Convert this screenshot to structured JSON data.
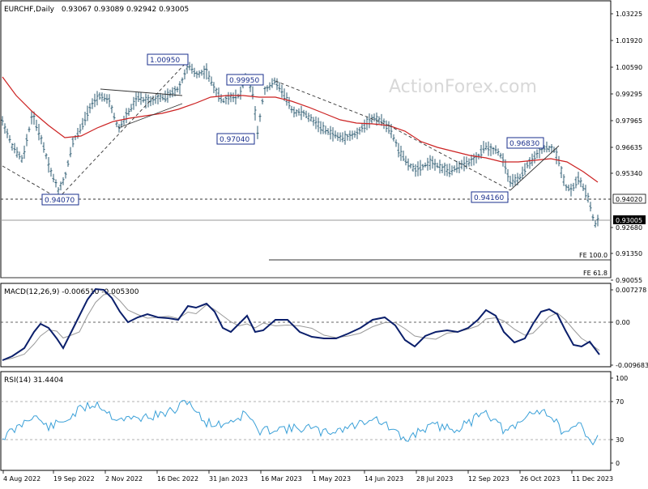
{
  "header": {
    "symbol": "EURCHF,Daily",
    "ohlc": "0.93067 0.93089 0.92942 0.93005"
  },
  "watermark": "ActionForex.com",
  "colors": {
    "candles": "#2f5d73",
    "ma": "#cc2222",
    "macd_line": "#0b1f6b",
    "macd_signal": "#999999",
    "rsi": "#3aa0d8",
    "box_border": "#1a2f8c",
    "dashed": "#333333"
  },
  "main_panel": {
    "price_axis_labels": [
      "1.03225",
      "1.01920",
      "1.00590",
      "0.99295",
      "0.97965",
      "0.96635",
      "0.95340",
      "0.94020",
      "0.93005",
      "0.92680",
      "0.91350",
      "0.90055"
    ],
    "current_price_label": "0.93005",
    "level_label_9402": "0.94020",
    "fe_labels": [
      "FE 100.0",
      "FE 61.8"
    ],
    "callouts": [
      "1.00950",
      "0.99950",
      "0.97040",
      "0.94070",
      "0.94160",
      "0.96830"
    ]
  },
  "macd_panel": {
    "title": "MACD(12,26,9) -0.006510 -0.005300",
    "axis_labels": [
      "0.007278",
      "0.00",
      "-0.009683"
    ]
  },
  "rsi_panel": {
    "title": "RSI(14) 31.4404",
    "axis_labels": [
      "100",
      "70",
      "30",
      "0"
    ]
  },
  "x_axis_labels": [
    "4 Aug 2022",
    "19 Sep 2022",
    "2 Nov 2022",
    "16 Dec 2022",
    "31 Jan 2023",
    "16 Mar 2023",
    "1 May 2023",
    "14 Jun 2023",
    "28 Jul 2023",
    "12 Sep 2023",
    "26 Oct 2023",
    "11 Dec 2023"
  ],
  "chart_data": [
    {
      "type": "line",
      "title": "EURCHF,Daily",
      "x": [
        "4 Aug 2022",
        "19 Sep 2022",
        "2 Nov 2022",
        "16 Dec 2022",
        "31 Jan 2023",
        "16 Mar 2023",
        "1 May 2023",
        "14 Jun 2023",
        "28 Jul 2023",
        "12 Sep 2023",
        "26 Oct 2023",
        "11 Dec 2023"
      ],
      "series": [
        {
          "name": "",
          "values": [
            0.978,
            0.944,
            0.972,
            0.986,
            0.994,
            0.987,
            0.973,
            0.974,
            0.953,
            0.964,
            0.963,
            0.93
          ]
        }
      ],
      "ylim": [
        0.9005,
        1.0323
      ]
    },
    {
      "type": "line",
      "title": "MACD(12,26,9) -0.006510 -0.005300",
      "x": [
        "4 Aug 2022",
        "19 Sep 2022",
        "2 Nov 2022",
        "16 Dec 2022",
        "31 Jan 2023",
        "16 Mar 2023",
        "1 May 2023",
        "14 Jun 2023",
        "28 Jul 2023",
        "12 Sep 2023",
        "26 Oct 2023",
        "11 Dec 2023"
      ],
      "series": [
        {
          "name": "",
          "values": [
            -0.0085,
            0.0,
            0.0072,
            0.001,
            0.0045,
            0.0005,
            -0.003,
            0.001,
            -0.0045,
            0.003,
            0.003,
            -0.0065
          ]
        }
      ],
      "ylim": [
        -0.0097,
        0.0073
      ]
    },
    {
      "type": "line",
      "title": "RSI(14) 31.4404",
      "x": [
        "4 Aug 2022",
        "19 Sep 2022",
        "2 Nov 2022",
        "16 Dec 2022",
        "31 Jan 2023",
        "16 Mar 2023",
        "1 May 2023",
        "14 Jun 2023",
        "28 Jul 2023",
        "12 Sep 2023",
        "26 Oct 2023",
        "11 Dec 2023"
      ],
      "series": [
        {
          "name": "",
          "values": [
            35,
            48,
            62,
            58,
            55,
            50,
            45,
            52,
            38,
            55,
            50,
            31.44
          ]
        }
      ],
      "ylim": [
        0,
        100
      ]
    }
  ]
}
